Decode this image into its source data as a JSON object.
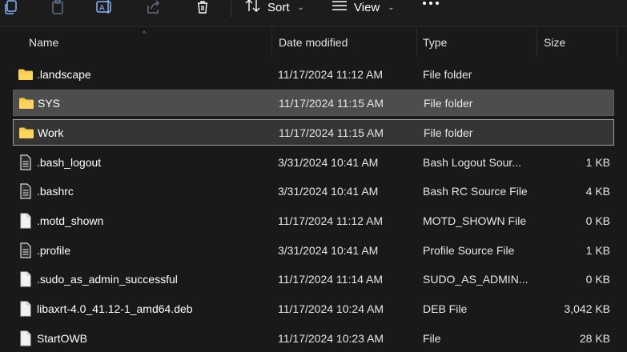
{
  "toolbar": {
    "icons": [
      "copy-icon",
      "paste-icon",
      "rename-icon",
      "share-icon",
      "delete-icon"
    ],
    "sort_label": "Sort",
    "view_label": "View",
    "more_label": "See more"
  },
  "columns": {
    "name": "Name",
    "date": "Date modified",
    "type": "Type",
    "size": "Size"
  },
  "files": [
    {
      "name": ".landscape",
      "date": "11/17/2024 11:12 AM",
      "type": "File folder",
      "size": "",
      "icon": "folder-icon",
      "state": ""
    },
    {
      "name": "SYS",
      "date": "11/17/2024 11:15 AM",
      "type": "File folder",
      "size": "",
      "icon": "folder-icon",
      "state": "selected"
    },
    {
      "name": "Work",
      "date": "11/17/2024 11:15 AM",
      "type": "File folder",
      "size": "",
      "icon": "folder-icon",
      "state": "focused"
    },
    {
      "name": ".bash_logout",
      "date": "3/31/2024 10:41 AM",
      "type": "Bash Logout Sour...",
      "size": "1 KB",
      "icon": "text-file-icon",
      "state": ""
    },
    {
      "name": ".bashrc",
      "date": "3/31/2024 10:41 AM",
      "type": "Bash RC Source File",
      "size": "4 KB",
      "icon": "text-file-icon",
      "state": ""
    },
    {
      "name": ".motd_shown",
      "date": "11/17/2024 11:12 AM",
      "type": "MOTD_SHOWN File",
      "size": "0 KB",
      "icon": "blank-file-icon",
      "state": ""
    },
    {
      "name": ".profile",
      "date": "3/31/2024 10:41 AM",
      "type": "Profile Source File",
      "size": "1 KB",
      "icon": "text-file-icon",
      "state": ""
    },
    {
      "name": ".sudo_as_admin_successful",
      "date": "11/17/2024 11:14 AM",
      "type": "SUDO_AS_ADMIN...",
      "size": "0 KB",
      "icon": "blank-file-icon",
      "state": ""
    },
    {
      "name": "libaxrt-4.0_41.12-1_amd64.deb",
      "date": "11/17/2024 10:24 AM",
      "type": "DEB File",
      "size": "3,042 KB",
      "icon": "blank-file-icon",
      "state": ""
    },
    {
      "name": "StartOWB",
      "date": "11/17/2024 10:23 AM",
      "type": "File",
      "size": "28 KB",
      "icon": "blank-file-icon",
      "state": ""
    }
  ],
  "colors": {
    "background": "#191919",
    "selected_row": "#4d4d4d",
    "focused_row": "#353535",
    "folder": "#f8c94a",
    "accent": "#8ab4f8"
  }
}
